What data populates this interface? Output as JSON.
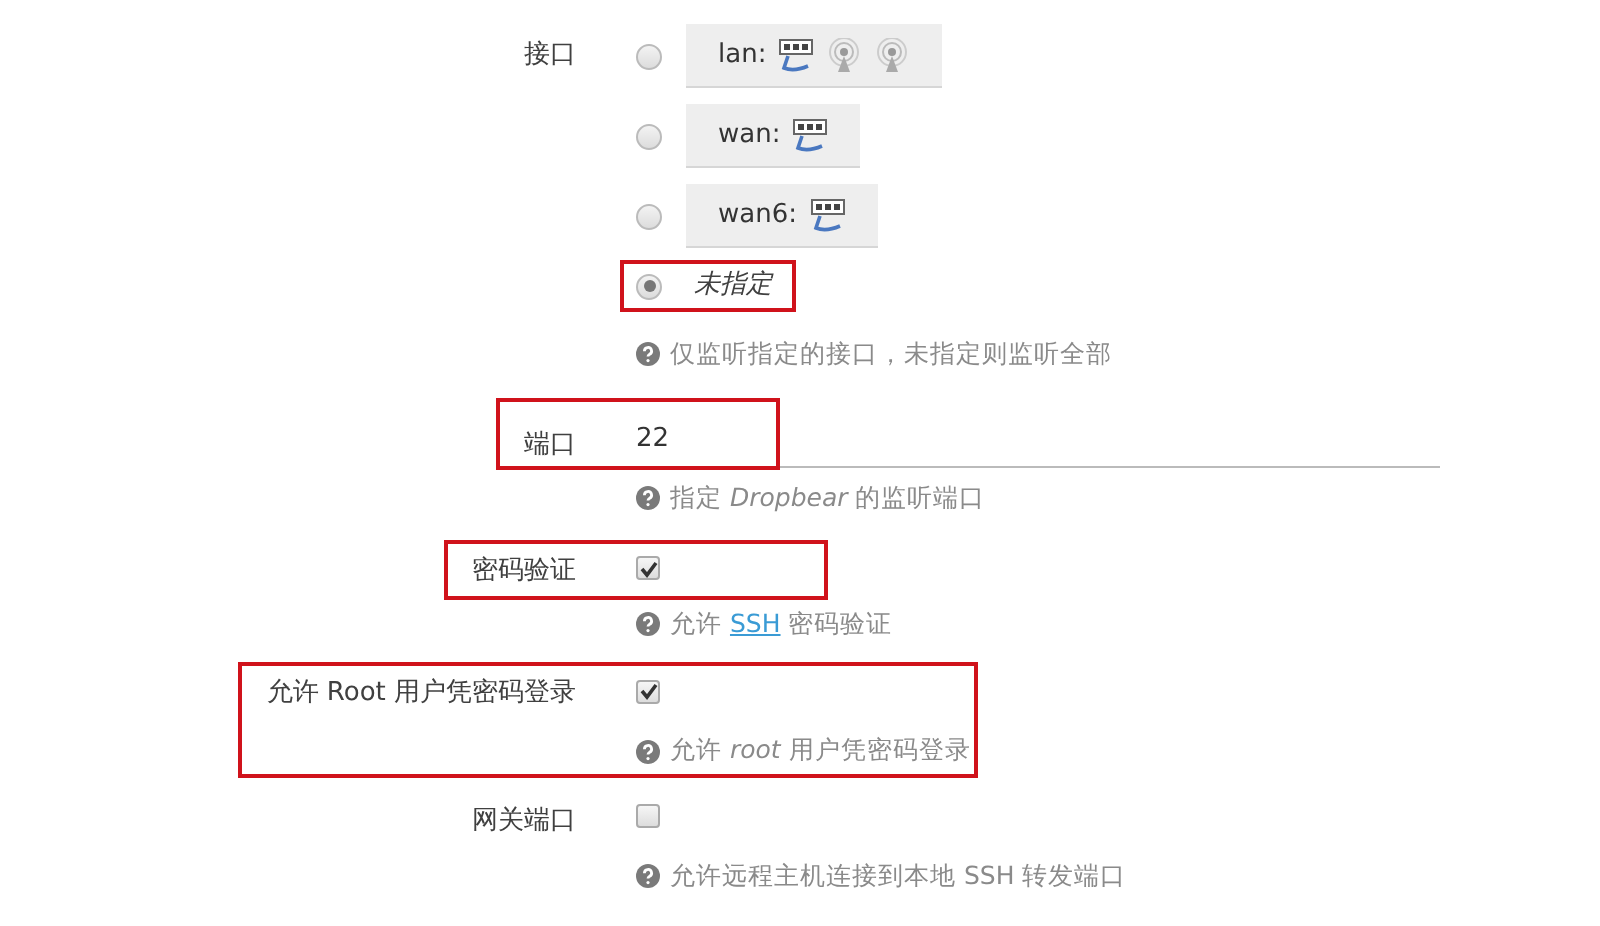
{
  "fields": [
    {
      "kind": "radio",
      "label": "接口",
      "highlighted": false,
      "options": [
        {
          "kind": "interface",
          "label": "lan:",
          "selected": false,
          "highlighted": false,
          "icons": [
            {
              "kind": "ethernet"
            },
            {
              "kind": "wireless"
            },
            {
              "kind": "wireless"
            }
          ]
        },
        {
          "kind": "interface",
          "label": "wan:",
          "selected": false,
          "highlighted": false,
          "icons": [
            {
              "kind": "ethernet"
            }
          ]
        },
        {
          "kind": "interface",
          "label": "wan6:",
          "selected": false,
          "highlighted": false,
          "icons": [
            {
              "kind": "ethernet"
            }
          ]
        },
        {
          "kind": "unspecified",
          "label": "未指定",
          "selected": true,
          "highlighted": true
        }
      ],
      "hint": [
        {
          "text": "仅监听指定的接口，未指定则监听全部"
        }
      ]
    },
    {
      "kind": "text",
      "label": "端口",
      "value": "22",
      "highlighted": true,
      "frame_covers_hint": false,
      "hint": [
        {
          "text": "指定 *Dropbear* 的监听端口"
        }
      ]
    },
    {
      "kind": "checkbox",
      "label": "密码验证",
      "checked": true,
      "highlighted": true,
      "frame_covers_hint": false,
      "hint": [
        {
          "text": "允许 "
        },
        {
          "text": "SSH",
          "kind": "link"
        },
        {
          "text": " 密码验证"
        }
      ]
    },
    {
      "kind": "checkbox",
      "label": "允许 Root 用户凭密码登录",
      "checked": true,
      "highlighted": true,
      "frame_covers_hint": true,
      "hint": [
        {
          "text": "允许 *root* 用户凭密码登录"
        }
      ]
    },
    {
      "kind": "checkbox",
      "label": "网关端口",
      "checked": false,
      "highlighted": false,
      "hint": [
        {
          "text": "允许远程主机连接到本地 SSH 转发端口"
        }
      ]
    }
  ]
}
